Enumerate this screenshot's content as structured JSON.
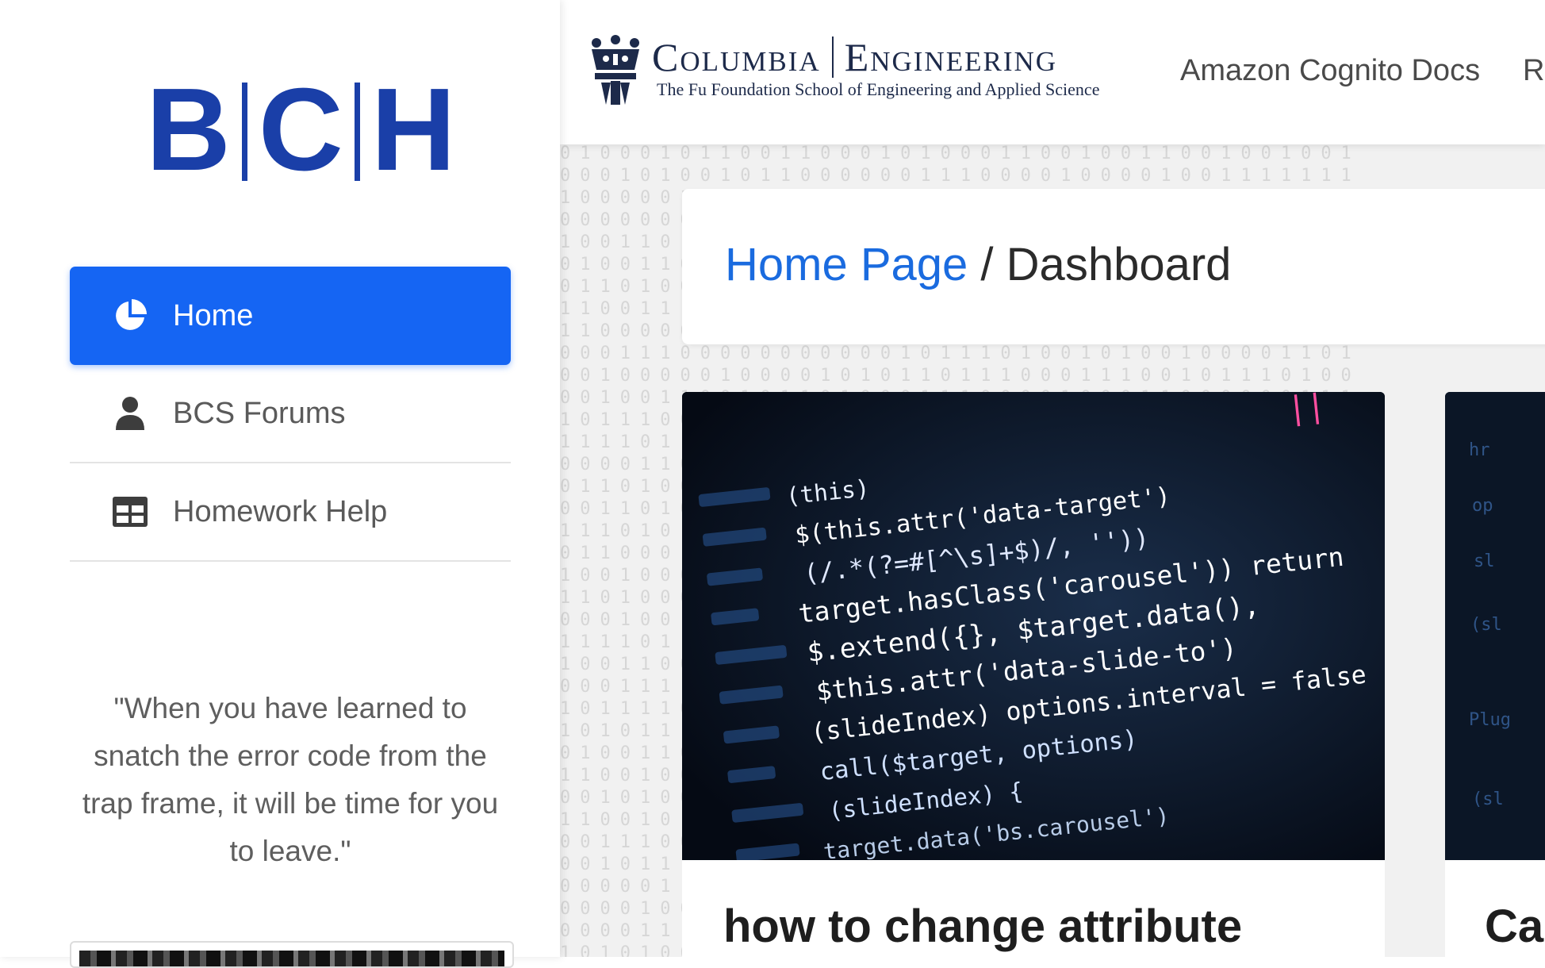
{
  "sidebar": {
    "logo": {
      "letters": [
        "B",
        "C",
        "H"
      ],
      "color": "#1a3fa8"
    },
    "nav": [
      {
        "label": "Home",
        "icon": "pie-chart-icon",
        "active": true
      },
      {
        "label": "BCS Forums",
        "icon": "user-icon",
        "active": false
      },
      {
        "label": "Homework Help",
        "icon": "table-icon",
        "active": false
      }
    ],
    "quote": "\"When you have learned to snatch the error code from the trap frame, it will be time for you to leave.\""
  },
  "header": {
    "brand": {
      "name_left": "Columbia",
      "name_right": "Engineering",
      "subtitle": "The Fu Foundation School of Engineering and Applied Science",
      "icon": "columbia-crown-icon"
    },
    "links": [
      "Amazon Cognito Docs",
      "Re"
    ]
  },
  "breadcrumb": {
    "link": "Home Page",
    "separator": "/",
    "current": "Dashboard"
  },
  "posts": [
    {
      "title": "how to change attribute",
      "image": "code-screenshot",
      "code_lines": [
        "(this)",
        "$(this.attr('data-target')",
        "(/.*(?=#[^\\s]+$)/, ''))",
        "target.hasClass('carousel')) return",
        "$.extend({}, $target.data(),",
        "$this.attr('data-slide-to')",
        "(slideIndex) options.interval = false",
        "call($target, options)",
        "(slideIndex) {",
        "target.data('bs.carousel')"
      ]
    },
    {
      "title": "Ca",
      "image": "code-screenshot"
    }
  ],
  "colors": {
    "accent": "#1565f3",
    "link": "#1a6bdf",
    "text": "#2b2b2b"
  }
}
